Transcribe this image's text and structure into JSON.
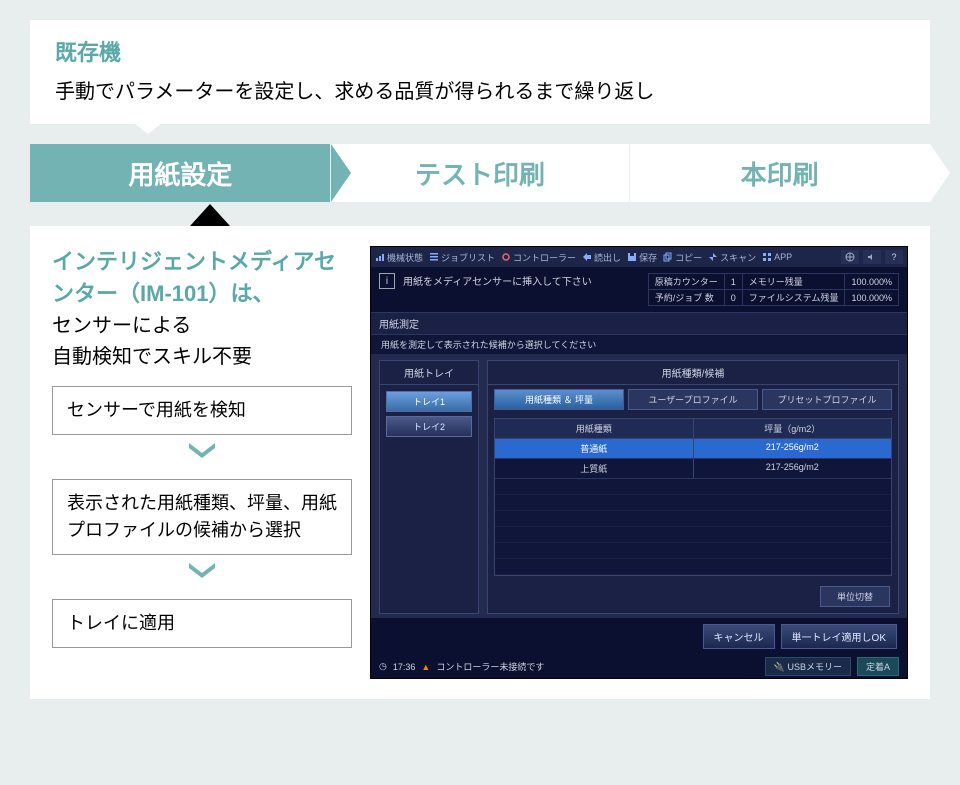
{
  "top": {
    "title": "既存機",
    "desc": "手動でパラメーターを設定し、求める品質が得られるまで繰り返し"
  },
  "flow": {
    "step1": "用紙設定",
    "step2": "テスト印刷",
    "step3": "本印刷"
  },
  "lead": {
    "line1": "インテリジェントメディアセンター（IM-101）は、",
    "line2": "センサーによる",
    "line3": "自動検知でスキル不要"
  },
  "steps": {
    "s1": "センサーで用紙を検知",
    "s2": "表示された用紙種類、坪量、用紙プロファイルの候補から選択",
    "s3": "トレイに適用"
  },
  "screen": {
    "titlebar": {
      "machine": "機械状態",
      "joblist": "ジョブリスト",
      "controller": "コントローラー",
      "readout": "読出し",
      "save": "保存",
      "copy": "コピー",
      "scan": "スキャン",
      "app": "APP"
    },
    "info_msg": "用紙をメディアセンサーに挿入して下さい",
    "status": {
      "r1c1": "原稿カウンター",
      "r1c2": "1",
      "r1c3": "メモリー残量",
      "r1c4": "100.000%",
      "r2c1": "予約/ジョブ 数",
      "r2c2": "0",
      "r2c3": "ファイルシステム残量",
      "r2c4": "100.000%"
    },
    "panel_title": "用紙測定",
    "panel_sub": "用紙を測定して表示された候補から選択してください",
    "tray_head": "用紙トレイ",
    "cand_head": "用紙種類/候補",
    "tray1": "トレイ1",
    "tray2": "トレイ2",
    "tab1": "用紙種類 ＆ 坪量",
    "tab2": "ユーザープロファイル",
    "tab3": "プリセットプロファイル",
    "col1": "用紙種類",
    "col2": "坪量（g/m2）",
    "row1c1": "普通紙",
    "row1c2": "217-256g/m2",
    "row2c1": "上質紙",
    "row2c2": "217-256g/m2",
    "unit_btn": "単位切替",
    "cancel": "キャンセル",
    "apply": "単一トレイ適用しOK",
    "footer_time": "17:36",
    "footer_msg": "コントローラー未接続です",
    "footer_usb": "USBメモリー",
    "footer_teiki": "定着A"
  }
}
